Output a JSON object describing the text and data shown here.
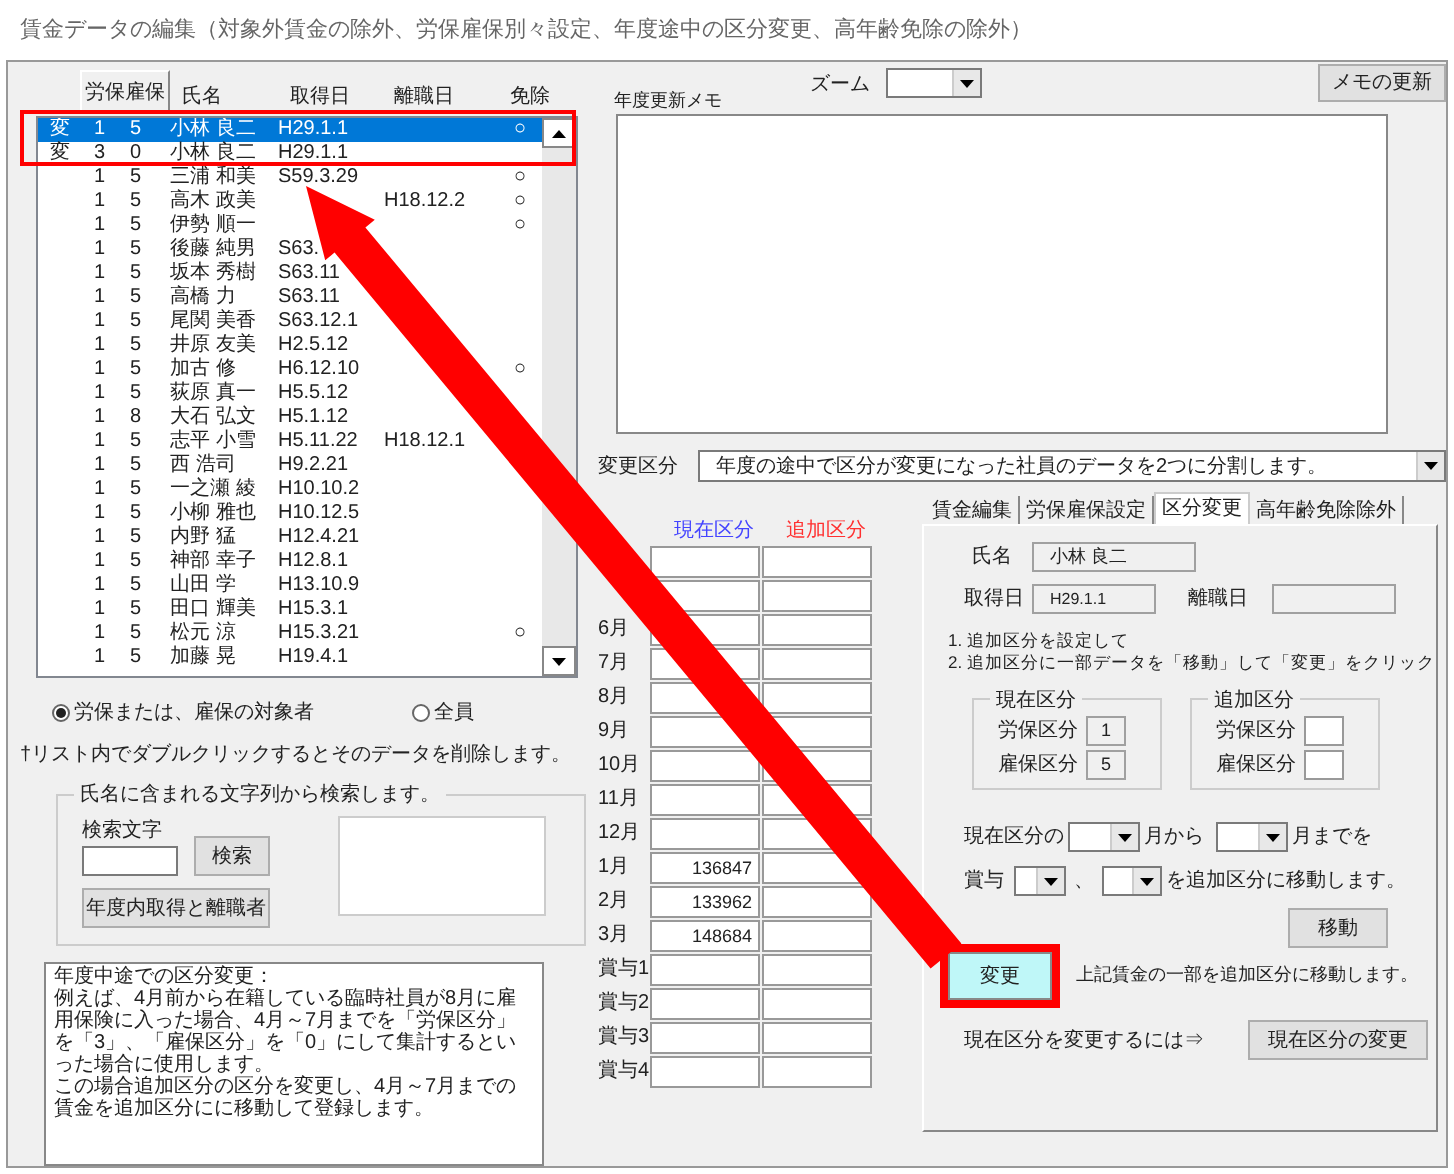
{
  "window": {
    "title": "賃金データの編集（対象外賃金の除外、労保雇保別々設定、年度途中の区分変更、高年齢免除の除外）"
  },
  "list": {
    "sort_button": "労保雇保",
    "columns": [
      "氏名",
      "取得日",
      "離職日",
      "免除"
    ],
    "rows": [
      {
        "mark": "変",
        "c1": "1",
        "c2": "5",
        "name": "小林 良二",
        "acquired": "H29.1.1",
        "exempt": "○",
        "selected": true
      },
      {
        "mark": "変",
        "c1": "3",
        "c2": "0",
        "name": "小林 良二",
        "acquired": "H29.1.1",
        "selected": false
      },
      {
        "c1": "1",
        "c2": "5",
        "name": "三浦 和美",
        "acquired": "S59.3.29",
        "exempt": "○",
        "selected": false
      },
      {
        "c1": "1",
        "c2": "5",
        "name": "高木 政美",
        "left": "H18.12.2",
        "exempt": "○",
        "selected": false
      },
      {
        "c1": "1",
        "c2": "5",
        "name": "伊勢 順一",
        "exempt": "○",
        "selected": false
      },
      {
        "c1": "1",
        "c2": "5",
        "name": "後藤 純男",
        "acquired": "S63.",
        "selected": false
      },
      {
        "c1": "1",
        "c2": "5",
        "name": "坂本 秀樹",
        "acquired": "S63.11",
        "selected": false
      },
      {
        "c1": "1",
        "c2": "5",
        "name": "高橋 力",
        "acquired": "S63.11",
        "selected": false
      },
      {
        "c1": "1",
        "c2": "5",
        "name": "尾関 美香",
        "acquired": "S63.12.1",
        "selected": false
      },
      {
        "c1": "1",
        "c2": "5",
        "name": "井原 友美",
        "acquired": "H2.5.12",
        "selected": false
      },
      {
        "c1": "1",
        "c2": "5",
        "name": "加古 修",
        "acquired": "H6.12.10",
        "exempt": "○",
        "selected": false
      },
      {
        "c1": "1",
        "c2": "5",
        "name": "荻原 真一",
        "acquired": "H5.5.12",
        "selected": false
      },
      {
        "c1": "1",
        "c2": "8",
        "name": "大石 弘文",
        "acquired": "H5.1.12",
        "selected": false
      },
      {
        "c1": "1",
        "c2": "5",
        "name": "志平 小雪",
        "acquired": "H5.11.22",
        "left": "H18.12.1",
        "selected": false
      },
      {
        "c1": "1",
        "c2": "5",
        "name": "西 浩司",
        "acquired": "H9.2.21",
        "selected": false
      },
      {
        "c1": "1",
        "c2": "5",
        "name": "一之瀬 綾",
        "acquired": "H10.10.2",
        "selected": false
      },
      {
        "c1": "1",
        "c2": "5",
        "name": "小柳 雅也",
        "acquired": "H10.12.5",
        "selected": false
      },
      {
        "c1": "1",
        "c2": "5",
        "name": "内野 猛",
        "acquired": "H12.4.21",
        "selected": false
      },
      {
        "c1": "1",
        "c2": "5",
        "name": "神部 幸子",
        "acquired": "H12.8.1",
        "selected": false
      },
      {
        "c1": "1",
        "c2": "5",
        "name": "山田 学",
        "acquired": "H13.10.9",
        "selected": false
      },
      {
        "c1": "1",
        "c2": "5",
        "name": "田口 輝美",
        "acquired": "H15.3.1",
        "selected": false
      },
      {
        "c1": "1",
        "c2": "5",
        "name": "松元 涼",
        "acquired": "H15.3.21",
        "exempt": "○",
        "selected": false
      },
      {
        "c1": "1",
        "c2": "5",
        "name": "加藤 晃",
        "acquired": "H19.4.1",
        "selected": false
      }
    ]
  },
  "radios": [
    {
      "label": "労保または、雇保の対象者",
      "selected": true
    },
    {
      "label": "全員",
      "selected": false
    }
  ],
  "note": "†リスト内でダブルクリックするとそのデータを削除します。",
  "search": {
    "legend": "氏名に含まれる文字列から検索します。",
    "label": "検索文字",
    "button": "検索",
    "year_button": "年度内取得と離職者"
  },
  "help": [
    "年度中途での区分変更：",
    "例えば、4月前から在籍している臨時社員が8月に雇用保険に入った場合、4月～7月までを「労保区分」を「3」、「雇保区分」を「0」にして集計するといった場合に使用します。",
    "この場合追加区分の区分を変更し、4月～7月までの賃金を追加区分にに移動して登録します。"
  ],
  "memo": {
    "label": "年度更新メモ",
    "zoom_label": "ズーム",
    "update_button": "メモの更新"
  },
  "change": {
    "label": "変更区分",
    "value": "年度の途中で区分が変更になった社員のデータを2つに分割します。"
  },
  "months": {
    "current_header": "現在区分",
    "added_header": "追加区分",
    "rows": [
      {},
      {},
      {
        "label": "6月"
      },
      {
        "label": "7月"
      },
      {
        "label": "8月"
      },
      {
        "label": "9月"
      },
      {
        "label": "10月"
      },
      {
        "label": "11月"
      },
      {
        "label": "12月"
      },
      {
        "label": "1月",
        "current": "136847"
      },
      {
        "label": "2月",
        "current": "133962"
      },
      {
        "label": "3月",
        "current": "148684"
      },
      {
        "label": "賞与1"
      },
      {
        "label": "賞与2"
      },
      {
        "label": "賞与3"
      },
      {
        "label": "賞与4"
      }
    ]
  },
  "tabs": [
    {
      "label": "賃金編集",
      "selected": false
    },
    {
      "label": "労保雇保設定",
      "selected": false
    },
    {
      "label": "区分変更",
      "selected": true
    },
    {
      "label": "高年齢免除除外",
      "selected": false
    }
  ],
  "panel": {
    "name_label": "氏名",
    "name": "小林 良二",
    "acquired_label": "取得日",
    "acquired": "H29.1.1",
    "left_label": "離職日",
    "steps": [
      "1. 追加区分を設定して",
      "2. 追加区分に一部データを「移動」して「変更」をクリック"
    ],
    "current_group": {
      "legend": "現在区分",
      "labor_label": "労保区分",
      "labor": "1",
      "employ_label": "雇保区分",
      "employ": "5"
    },
    "added_group": {
      "legend": "追加区分",
      "labor_label": "労保区分",
      "employ_label": "雇保区分"
    },
    "range": [
      "現在区分の",
      "月から",
      "月までを"
    ],
    "bonus": [
      "賞与",
      "、",
      "を追加区分に移動します。"
    ],
    "move_button": "移動",
    "change_button": "変更",
    "change_note": "上記賃金の一部を追加区分に移動します。",
    "switch_note": "現在区分を変更するには⇒",
    "switch_button": "現在区分の変更"
  }
}
